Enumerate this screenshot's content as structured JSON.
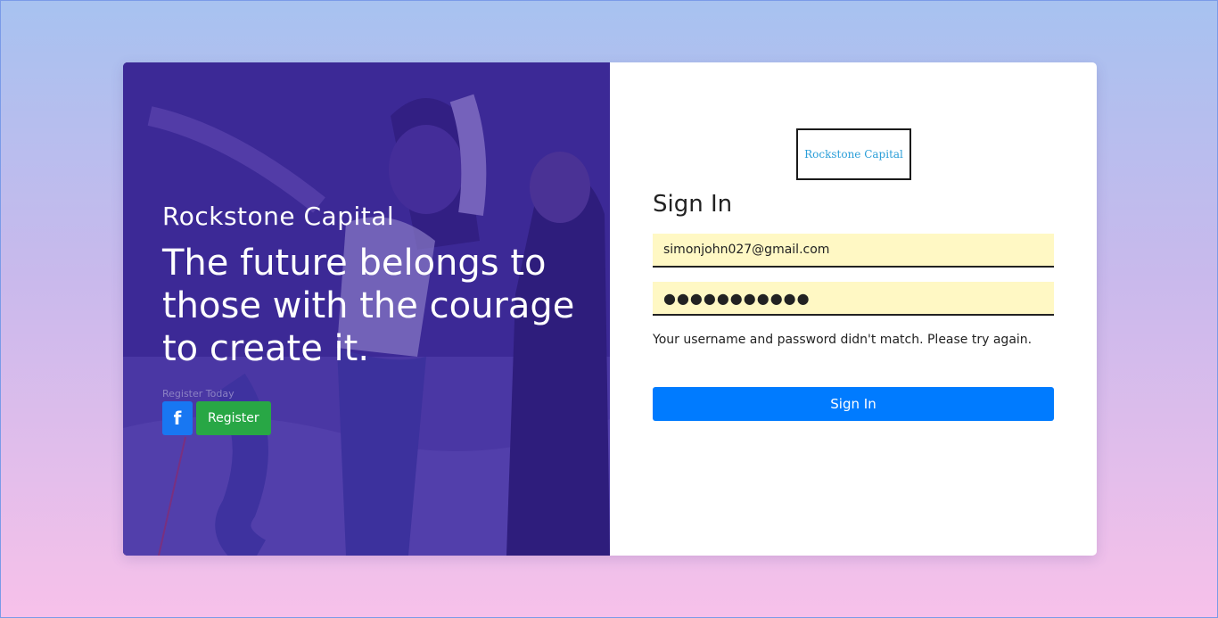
{
  "hero": {
    "brand": "Rockstone Capital",
    "quote": "The future belongs to those with the courage to create it.",
    "register_caption": "Register Today",
    "facebook_icon": "f",
    "register_label": "Register"
  },
  "form": {
    "logo_text": "Rockstone Capital",
    "title": "Sign In",
    "email_value": "simonjohn027@gmail.com",
    "password_mask": "●●●●●●●●●●●",
    "error_message": "Your username and password didn't match. Please try again.",
    "submit_label": "Sign In"
  },
  "colors": {
    "facebook": "#1877f2",
    "register": "#28a745",
    "submit": "#007bff",
    "field_fill": "#fff8c4",
    "hero_overlay": "#3e28a0",
    "logo_text": "#2a9ed8"
  }
}
